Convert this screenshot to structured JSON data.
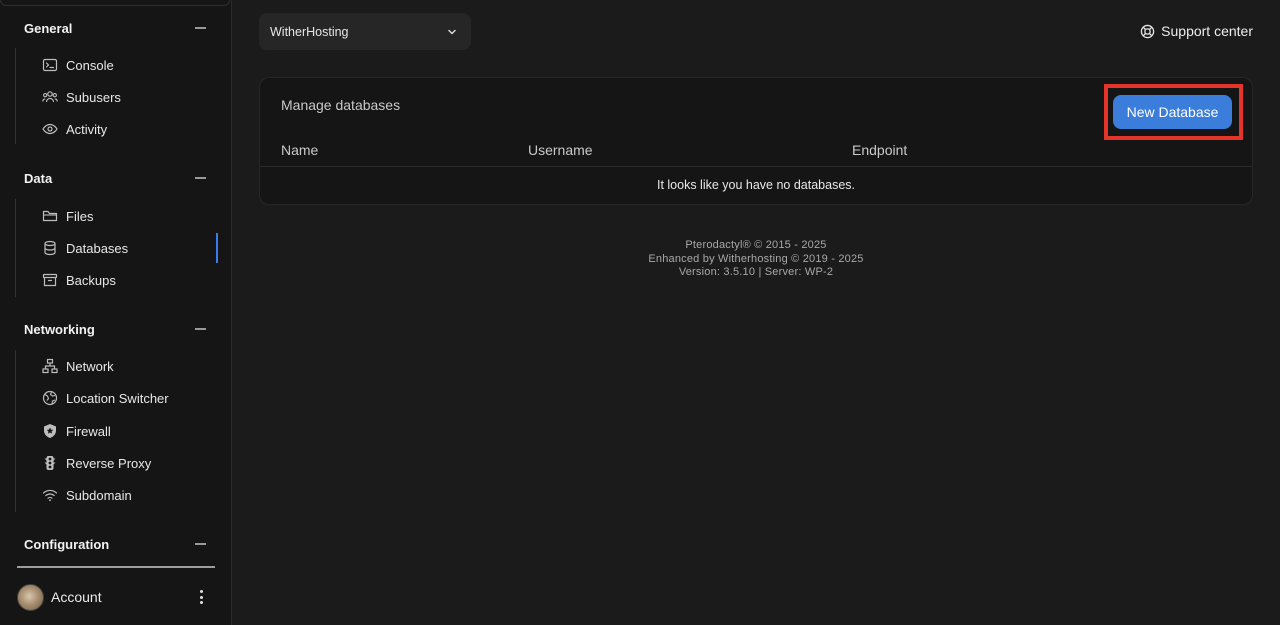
{
  "sidebar": {
    "sections": {
      "general": "General",
      "data": "Data",
      "networking": "Networking",
      "configuration": "Configuration"
    },
    "items": {
      "console": "Console",
      "subusers": "Subusers",
      "activity": "Activity",
      "files": "Files",
      "databases": "Databases",
      "backups": "Backups",
      "network": "Network",
      "location_switcher": "Location Switcher",
      "firewall": "Firewall",
      "reverse_proxy": "Reverse Proxy",
      "subdomain": "Subdomain"
    },
    "active_item": "databases",
    "account_label": "Account"
  },
  "header": {
    "server_name": "WitherHosting",
    "support_label": "Support center"
  },
  "databases": {
    "title": "Manage databases",
    "new_button": "New Database",
    "columns": [
      "Name",
      "Username",
      "Endpoint"
    ],
    "empty_message": "It looks like you have no databases."
  },
  "footer": {
    "line1": "Pterodactyl® © 2015 - 2025",
    "line2": "Enhanced by Witherhosting © 2019 - 2025",
    "line3": "Version: 3.5.10 | Server: WP-2"
  },
  "colors": {
    "accent": "#3a7ddb",
    "active_marker": "#3b7bf0",
    "highlight": "#e3352a",
    "background": "#1b1b1b",
    "sidebar": "#151515"
  }
}
